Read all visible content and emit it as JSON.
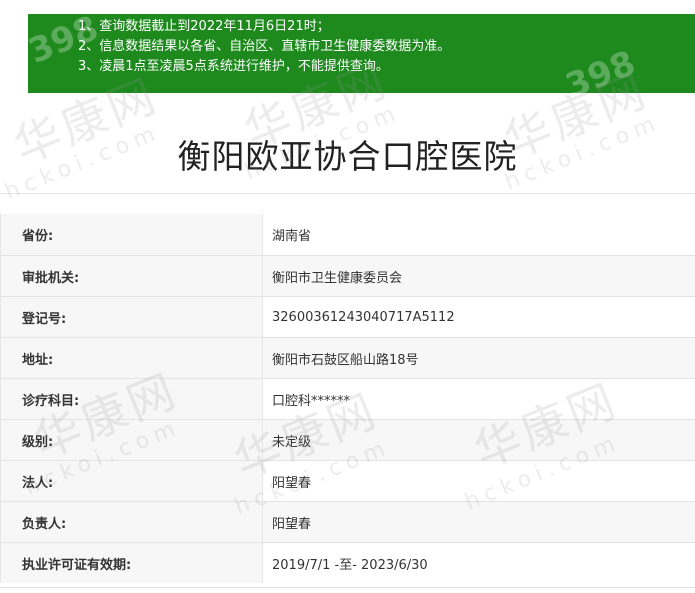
{
  "notice": {
    "lines": [
      "1、查询数据截止到2022年11月6日21时；",
      "2、信息数据结果以各省、自治区、直辖市卫生健康委数据为准。",
      "3、凌晨1点至凌晨5点系统进行维护，不能提供查询。"
    ]
  },
  "title": "衡阳欧亚协合口腔医院",
  "details": [
    {
      "label": "省份:",
      "value": "湖南省"
    },
    {
      "label": "审批机关:",
      "value": "衡阳市卫生健康委员会"
    },
    {
      "label": "登记号:",
      "value": "32600361243040717A5112"
    },
    {
      "label": "地址:",
      "value": "衡阳市石鼓区船山路18号"
    },
    {
      "label": "诊疗科目:",
      "value": "口腔科******"
    },
    {
      "label": "级别:",
      "value": "未定级"
    },
    {
      "label": "法人:",
      "value": "阳望春"
    },
    {
      "label": "负责人:",
      "value": "阳望春"
    },
    {
      "label": "执业许可证有效期:",
      "value": "2019/7/1 -至- 2023/6/30"
    }
  ],
  "watermark": {
    "brand": "华康网",
    "domain": "hckoi.com",
    "number": "398"
  }
}
